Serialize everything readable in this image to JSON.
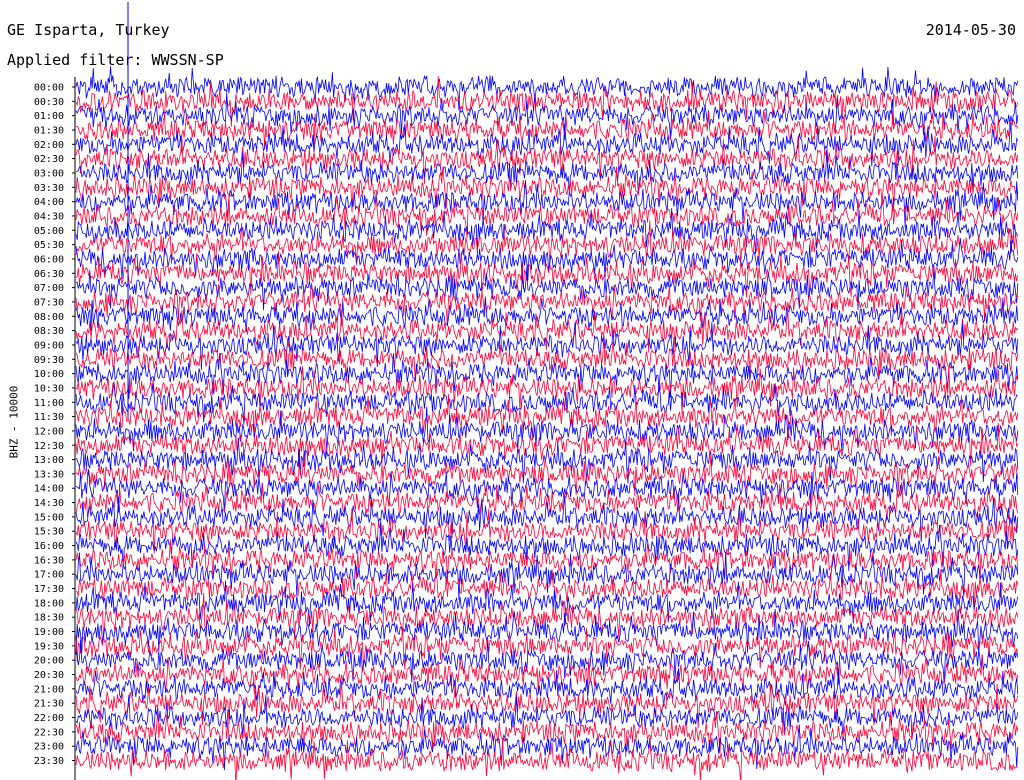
{
  "header": {
    "station": "GE Isparta, Turkey",
    "date": "2014-05-30",
    "filter": "Applied filter: WWSSN-SP"
  },
  "chart_data": {
    "type": "line",
    "title": "GE Isparta, Turkey",
    "subtitle": "Applied filter: WWSSN-SP",
    "ylabel": "BHZ - 10000",
    "date": "2014-05-30",
    "row_labels": [
      "00:00",
      "00:30",
      "01:00",
      "01:30",
      "02:00",
      "02:30",
      "03:00",
      "03:30",
      "04:00",
      "04:30",
      "05:00",
      "05:30",
      "06:00",
      "06:30",
      "07:00",
      "07:30",
      "08:00",
      "08:30",
      "09:00",
      "09:30",
      "10:00",
      "10:30",
      "11:00",
      "11:30",
      "12:00",
      "12:30",
      "13:00",
      "13:30",
      "14:00",
      "14:30",
      "15:00",
      "15:30",
      "16:00",
      "16:30",
      "17:00",
      "17:30",
      "18:00",
      "18:30",
      "19:00",
      "19:30",
      "20:00",
      "20:30",
      "21:00",
      "21:30",
      "22:00",
      "22:30",
      "23:00",
      "23:30"
    ],
    "trace_colors": [
      "#0000ff",
      "#ff0033"
    ],
    "grid": false
  }
}
